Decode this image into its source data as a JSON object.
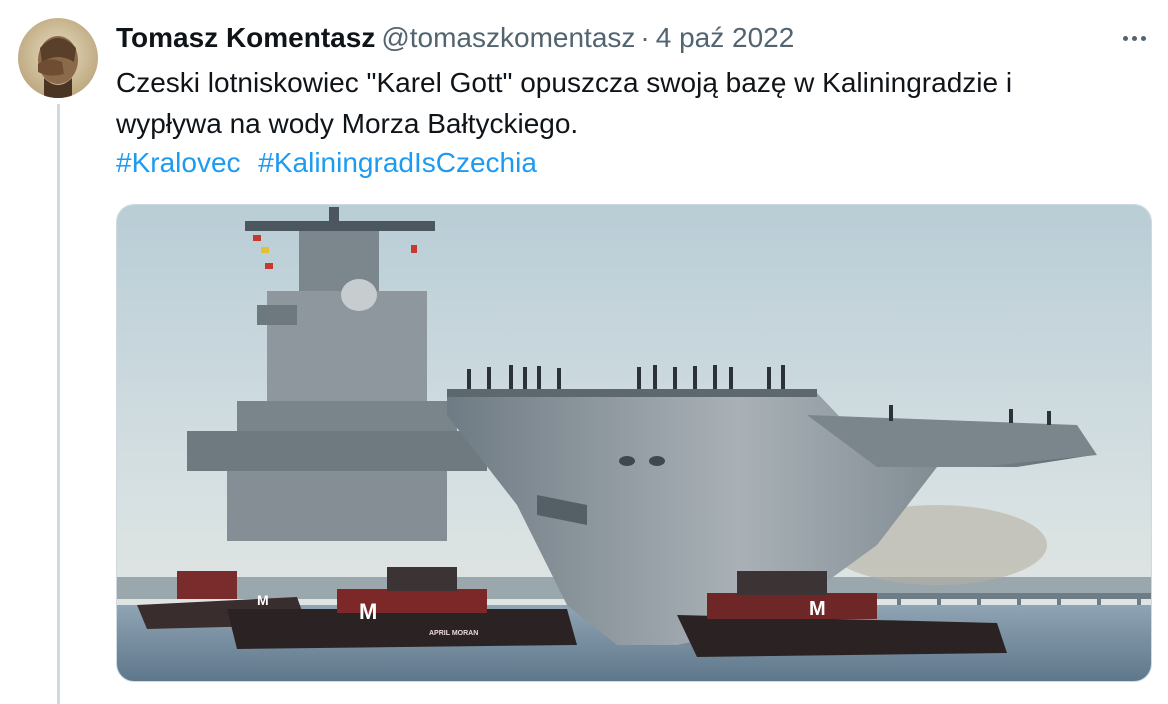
{
  "author": {
    "name": "Tomasz Komentasz",
    "handle": "@tomaszkomentasz",
    "separator": "·",
    "date": "4 paź 2022"
  },
  "tweet": {
    "text_line1": "Czeski lotniskowiec \"Karel Gott\" opuszcza swoją bazę w Kaliningradzie i",
    "text_line2": "wypływa na wody Morza Bałtyckiego.",
    "hashtags": [
      "#Kralovec",
      "#KaliningradIsCzechia"
    ]
  },
  "media": {
    "tug_letters": [
      "M",
      "M",
      "M"
    ],
    "tug_name": "APRIL MORAN"
  },
  "icons": {
    "more": "more-horizontal-icon",
    "avatar": "avatar-image"
  },
  "colors": {
    "link": "#1d9bf0",
    "secondary_text": "#536471",
    "border": "#cfd9de"
  }
}
